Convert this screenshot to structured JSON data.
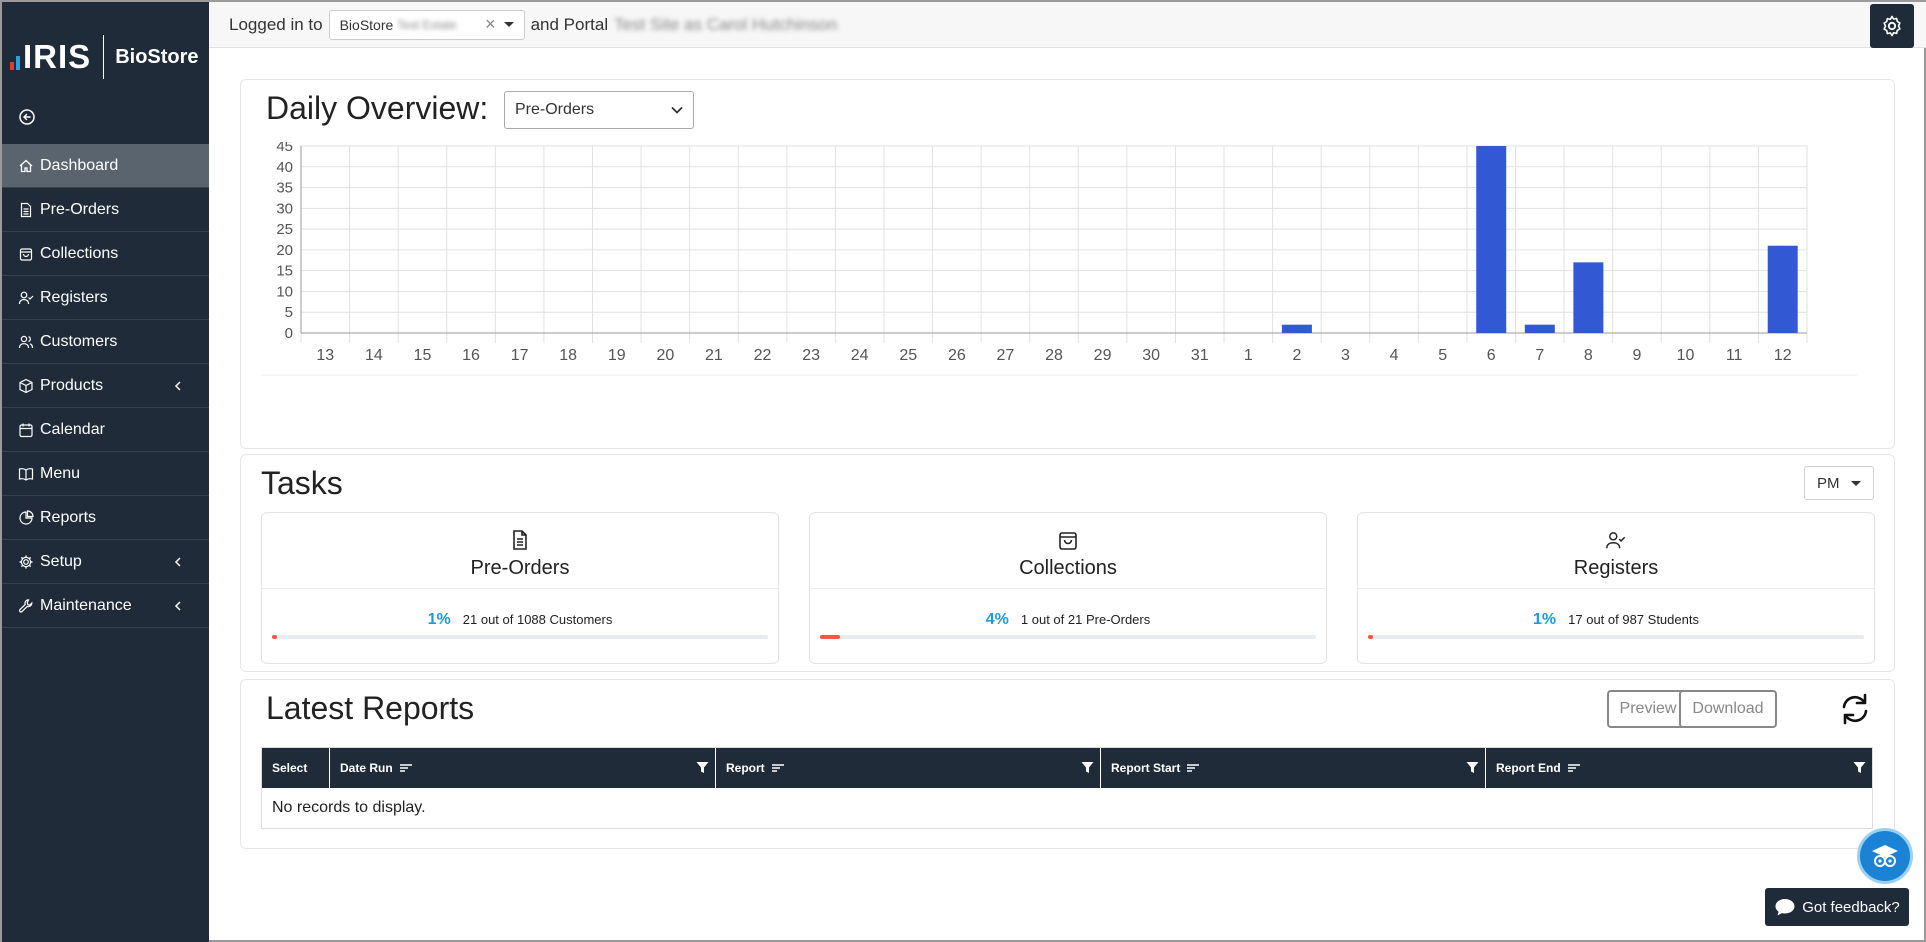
{
  "brand": {
    "name": "IRIS",
    "product": "BioStore"
  },
  "sidebar": {
    "items": [
      {
        "label": "Dashboard",
        "icon": "home-icon",
        "active": true
      },
      {
        "label": "Pre-Orders",
        "icon": "document-icon"
      },
      {
        "label": "Collections",
        "icon": "bag-icon"
      },
      {
        "label": "Registers",
        "icon": "user-check-icon"
      },
      {
        "label": "Customers",
        "icon": "users-icon"
      },
      {
        "label": "Products",
        "icon": "box-icon",
        "submenu": true
      },
      {
        "label": "Calendar",
        "icon": "calendar-icon"
      },
      {
        "label": "Menu",
        "icon": "book-icon"
      },
      {
        "label": "Reports",
        "icon": "pie-chart-icon"
      },
      {
        "label": "Setup",
        "icon": "gear-icon",
        "submenu": true
      },
      {
        "label": "Maintenance",
        "icon": "wrench-icon",
        "submenu": true
      }
    ]
  },
  "topbar": {
    "logged_in_text": "Logged in to",
    "site_prefix": "BioStore",
    "site_name": "Test Estate",
    "portal_text": "and Portal",
    "portal_name": "Test Site as Carol Hutchinson"
  },
  "overview": {
    "title": "Daily Overview:",
    "selected_view": "Pre-Orders"
  },
  "chart_data": {
    "type": "bar",
    "categories": [
      "13",
      "14",
      "15",
      "16",
      "17",
      "18",
      "19",
      "20",
      "21",
      "22",
      "23",
      "24",
      "25",
      "26",
      "27",
      "28",
      "29",
      "30",
      "31",
      "1",
      "2",
      "3",
      "4",
      "5",
      "6",
      "7",
      "8",
      "9",
      "10",
      "11",
      "12"
    ],
    "values": [
      0,
      0,
      0,
      0,
      0,
      0,
      0,
      0,
      0,
      0,
      0,
      0,
      0,
      0,
      0,
      0,
      0,
      0,
      0,
      0,
      2,
      0,
      0,
      0,
      45,
      2,
      17,
      0,
      0,
      0,
      21
    ],
    "ylim": [
      0,
      45
    ],
    "yticks": [
      0,
      5,
      10,
      15,
      20,
      25,
      30,
      35,
      40,
      45
    ],
    "grid": true,
    "bar_color": "#3358d4"
  },
  "tasks": {
    "title": "Tasks",
    "period": "PM",
    "cards": [
      {
        "title": "Pre-Orders",
        "icon": "document-icon",
        "percent": "1%",
        "progress": 0.01,
        "detail": "21 out of 1088 Customers"
      },
      {
        "title": "Collections",
        "icon": "bag-icon",
        "percent": "4%",
        "progress": 0.04,
        "detail": "1 out of 21 Pre-Orders"
      },
      {
        "title": "Registers",
        "icon": "user-check-icon",
        "percent": "1%",
        "progress": 0.01,
        "detail": "17 out of 987 Students"
      }
    ]
  },
  "reports": {
    "title": "Latest Reports",
    "preview_label": "Preview",
    "download_label": "Download",
    "columns": [
      "Select",
      "Date Run",
      "Report",
      "Report Start",
      "Report End"
    ],
    "empty_text": "No records to display."
  },
  "feedback": {
    "label": "Got feedback?"
  },
  "colors": {
    "sidebar": "#1f2b38",
    "accent": "#1a9be0",
    "progress": "#f05a3b",
    "bar": "#3358d4"
  }
}
